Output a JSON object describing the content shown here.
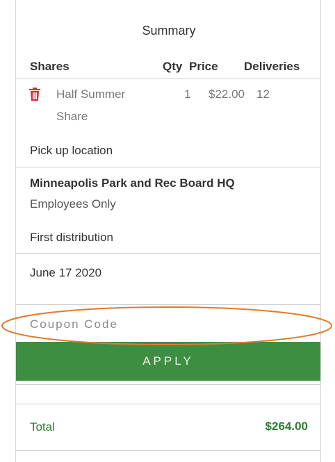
{
  "summary": {
    "title": "Summary"
  },
  "shares_table": {
    "headers": {
      "shares": "Shares",
      "qty": "Qty",
      "price": "Price",
      "deliveries": "Deliveries"
    },
    "rows": [
      {
        "name_line1": "Half Summer",
        "name_line2": "Share",
        "qty": "1",
        "price": "$22.00",
        "deliveries": "12",
        "icon": "trash-icon"
      }
    ]
  },
  "pickup": {
    "label": "Pick up location",
    "name": "Minneapolis Park and Rec Board HQ",
    "note": "Employees Only"
  },
  "distribution": {
    "label": "First distribution",
    "date": "June 17 2020"
  },
  "coupon": {
    "placeholder": "Coupon Code",
    "value": ""
  },
  "apply_button": {
    "label": "APPLY"
  },
  "total": {
    "label": "Total",
    "value": "$264.00"
  },
  "colors": {
    "accent_green": "#3e8e41",
    "total_green": "#2e7d32",
    "delete_red": "#d32f2f",
    "highlight_orange": "#e07b2c"
  }
}
